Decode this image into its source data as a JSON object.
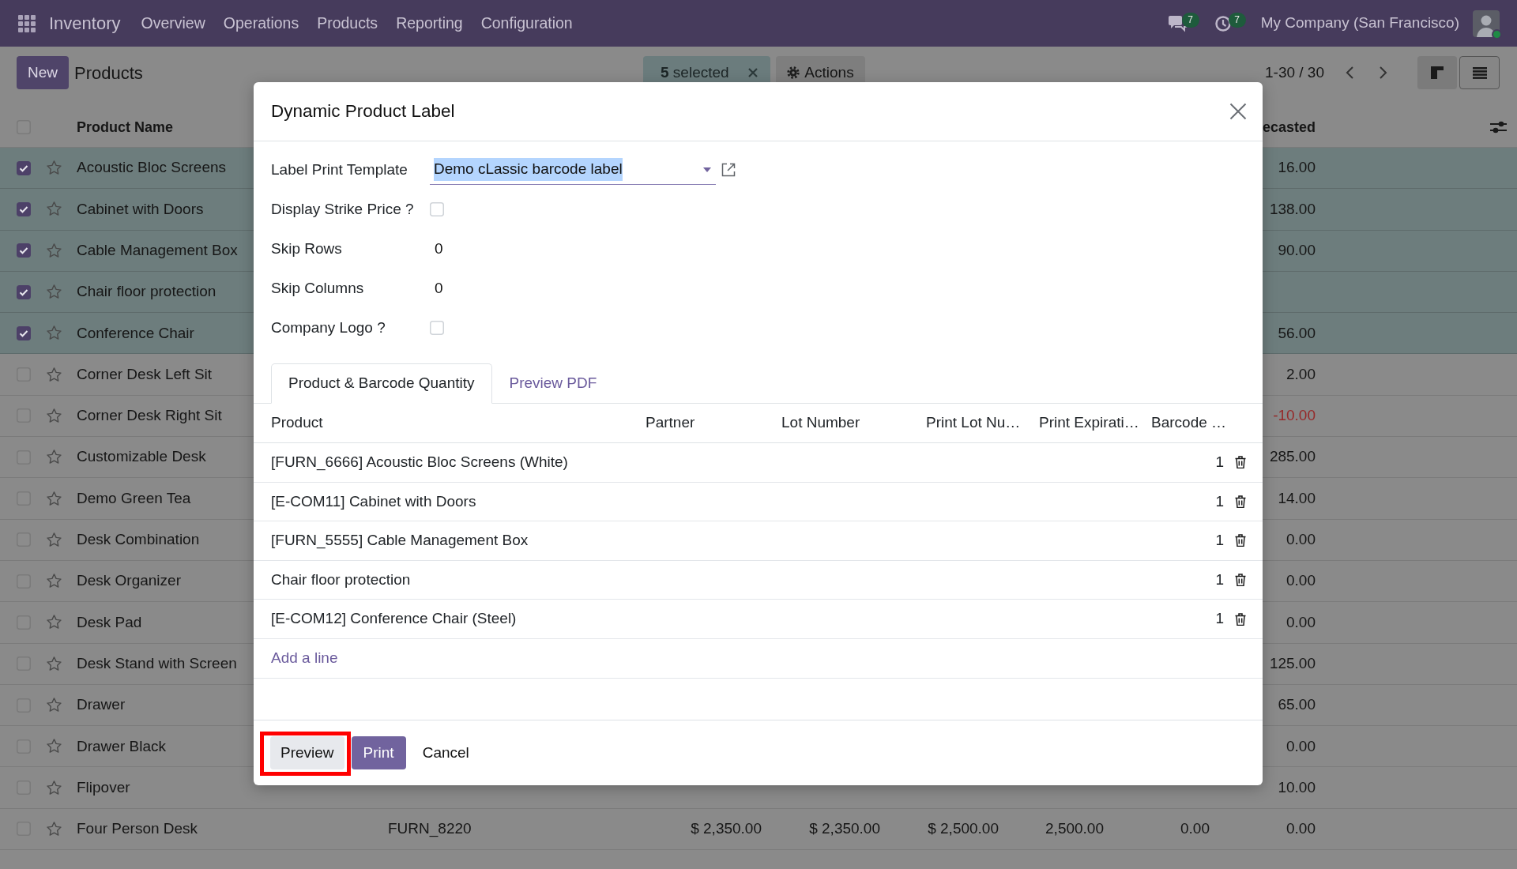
{
  "navbar": {
    "app": "Inventory",
    "menu": [
      "Overview",
      "Operations",
      "Products",
      "Reporting",
      "Configuration"
    ],
    "messages_badge": "7",
    "activities_badge": "7",
    "company": "My Company (San Francisco)",
    "user_online": true
  },
  "control_panel": {
    "new_button": "New",
    "title": "Products",
    "selection": "**5** selected",
    "actions": "Actions",
    "pager": "1-30 / 30",
    "views": [
      {
        "kind": "kanban",
        "selected": false
      },
      {
        "kind": "list",
        "selected": true
      }
    ]
  },
  "list": {
    "header_checked": false,
    "columns": [
      {
        "kind": "name",
        "label": "Product Name"
      },
      {
        "kind": "forecast",
        "label": "ecasted"
      }
    ],
    "rows": [
      {
        "selected": true,
        "favorite": false,
        "name": "Acoustic Bloc Screens",
        "forecast": {
          "value": "16.00",
          "alert": false
        }
      },
      {
        "selected": true,
        "favorite": false,
        "name": "Cabinet with Doors",
        "forecast": {
          "value": "138.00",
          "alert": false
        }
      },
      {
        "selected": true,
        "favorite": false,
        "name": "Cable Management Box",
        "forecast": {
          "value": "90.00",
          "alert": false
        }
      },
      {
        "selected": true,
        "favorite": false,
        "name": "Chair floor protection"
      },
      {
        "selected": true,
        "favorite": false,
        "name": "Conference Chair",
        "forecast": {
          "value": "56.00",
          "alert": false
        }
      },
      {
        "selected": false,
        "favorite": false,
        "name": "Corner Desk Left Sit",
        "forecast": {
          "value": "2.00",
          "alert": false
        }
      },
      {
        "selected": false,
        "favorite": false,
        "name": "Corner Desk Right Sit",
        "forecast": {
          "value": "-10.00",
          "alert": true
        }
      },
      {
        "selected": false,
        "favorite": false,
        "name": "Customizable Desk",
        "forecast": {
          "value": "285.00",
          "alert": false
        }
      },
      {
        "selected": false,
        "favorite": false,
        "name": "Demo Green Tea",
        "forecast": {
          "value": "14.00",
          "alert": false
        }
      },
      {
        "selected": false,
        "favorite": false,
        "name": "Desk Combination",
        "forecast": {
          "value": "0.00",
          "alert": false
        }
      },
      {
        "selected": false,
        "favorite": false,
        "name": "Desk Organizer",
        "forecast": {
          "value": "0.00",
          "alert": false
        }
      },
      {
        "selected": false,
        "favorite": false,
        "name": "Desk Pad",
        "forecast": {
          "value": "0.00",
          "alert": false
        }
      },
      {
        "selected": false,
        "favorite": false,
        "name": "Desk Stand with Screen",
        "forecast": {
          "value": "125.00",
          "alert": false
        }
      },
      {
        "selected": false,
        "favorite": false,
        "name": "Drawer",
        "forecast": {
          "value": "65.00",
          "alert": false
        }
      },
      {
        "selected": false,
        "favorite": false,
        "name": "Drawer Black",
        "forecast": {
          "value": "0.00",
          "alert": false
        }
      },
      {
        "selected": false,
        "favorite": false,
        "name": "Flipover",
        "forecast": {
          "value": "10.00",
          "alert": false
        }
      },
      {
        "selected": false,
        "favorite": false,
        "name": "Four Person Desk",
        "details": [
          "FURN_8220",
          "$ 2,350.00",
          "$ 2,350.00",
          "$ 2,500.00",
          "2,500.00",
          "0.00"
        ],
        "forecast": {
          "value": "0.00",
          "alert": false
        }
      }
    ]
  },
  "dialog": {
    "title": "Dynamic Product Label",
    "fields": [
      {
        "kind": "select",
        "label": "Label Print Template",
        "value": "Demo cLassic barcode label",
        "text_selected": true
      },
      {
        "kind": "checkbox",
        "label": "Display Strike Price ?",
        "checked": false
      },
      {
        "kind": "number",
        "label": "Skip Rows",
        "value": "0"
      },
      {
        "kind": "number",
        "label": "Skip Columns",
        "value": "0"
      },
      {
        "kind": "checkbox",
        "label": "Company Logo ?",
        "checked": false
      }
    ],
    "tabs": [
      {
        "label": "Product & Barcode Quantity",
        "selected": true
      },
      {
        "label": "Preview PDF",
        "selected": false
      }
    ],
    "lines": {
      "columns": [
        "Product",
        "Partner",
        "Lot Number",
        "Print Lot Nu…",
        "Print Expirati…",
        "Barcode …"
      ],
      "rows": [
        {
          "product": "[FURN_6666] Acoustic Bloc Screens (White)",
          "quantity": "1"
        },
        {
          "product": "[E-COM11] Cabinet with Doors",
          "quantity": "1"
        },
        {
          "product": "[FURN_5555] Cable Management Box",
          "quantity": "1"
        },
        {
          "product": "Chair floor protection",
          "quantity": "1"
        },
        {
          "product": "[E-COM12] Conference Chair (Steel)",
          "quantity": "1"
        }
      ],
      "add_line": "Add a line"
    },
    "buttons": [
      {
        "kind": "secondary",
        "label": "Preview",
        "highlighted": true
      },
      {
        "kind": "primary",
        "label": "Print",
        "highlighted": false
      },
      {
        "kind": "link",
        "label": "Cancel",
        "highlighted": false
      }
    ]
  }
}
